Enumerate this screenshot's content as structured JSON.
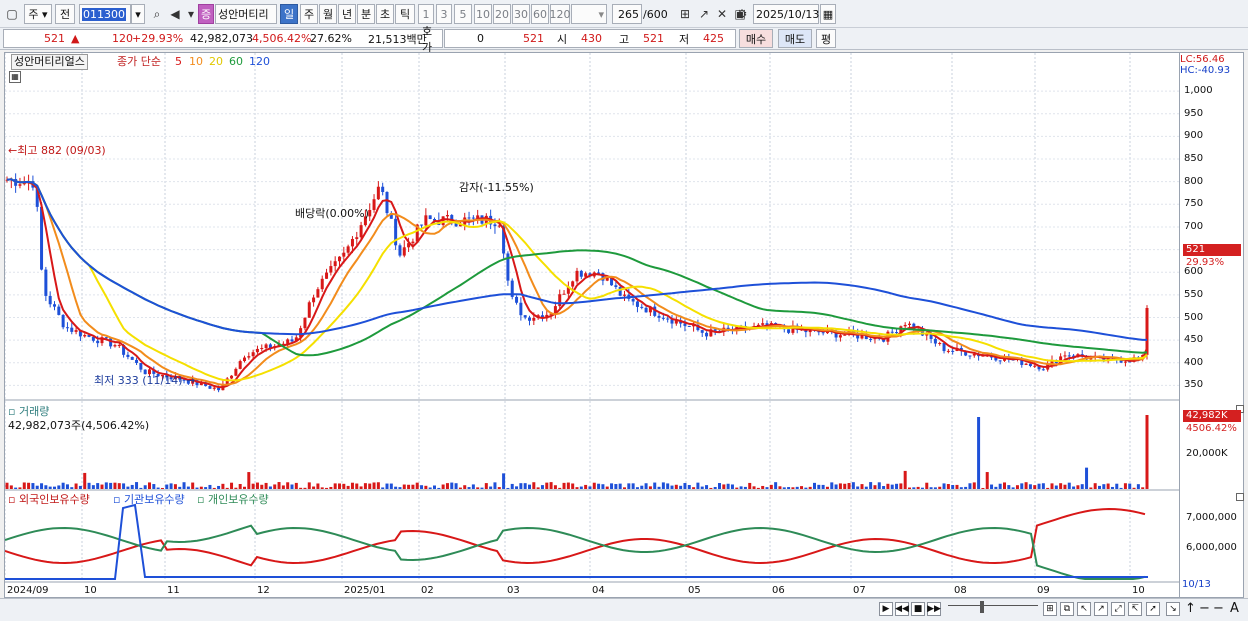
{
  "toolbar": {
    "period_mode": "주",
    "prev_label": "전",
    "code_value": "011300",
    "stock_badge": "증",
    "stock_name": "성안머티리",
    "timeframes": [
      "일",
      "주",
      "월",
      "년",
      "분",
      "초",
      "틱"
    ],
    "active_timeframe": "일",
    "intervals": [
      "1",
      "3",
      "5",
      "10",
      "20",
      "30",
      "60",
      "120"
    ],
    "count_value": "265",
    "count_max": "/600",
    "date_value": "2025/10/13"
  },
  "quote": {
    "price": "521",
    "change": "120",
    "change_pct": "+29.93%",
    "volume": "42,982,073",
    "volume_pct": "4,506.42%",
    "turnover_pct": "27.62%",
    "amount": "21,513백만",
    "hoga_label": "호가",
    "hoga_value": "0",
    "hoga_price": "521",
    "open_label": "시",
    "open": "430",
    "high_label": "고",
    "high": "521",
    "low_label": "저",
    "low": "425",
    "buy_label": "매수",
    "sell_label": "매도",
    "eval_label": "평"
  },
  "legend": {
    "name": "성안머티리얼스",
    "ma_label": "종가 단순",
    "ma_periods": [
      "5",
      "10",
      "20",
      "60",
      "120"
    ],
    "ma_colors": [
      "#d81818",
      "#f28c1c",
      "#f5e000",
      "#1e9a3c",
      "#1e50d8"
    ]
  },
  "annotations": {
    "high": "←최고 882 (09/03)",
    "low": "최저 333 (11/14) →",
    "dividend": "배당락(0.00%)",
    "capital_reduction": "감자(-11.55%)"
  },
  "price_axis": {
    "lc": "LC:56.46",
    "hc": "HC:-40.93",
    "ticks": [
      "1,000",
      "950",
      "900",
      "850",
      "800",
      "750",
      "700",
      "650",
      "600",
      "550",
      "500",
      "450",
      "400",
      "350"
    ],
    "last_price": "521",
    "last_change": "29.93%"
  },
  "volume_panel": {
    "title": "거래량",
    "value": "42,982,073주(4,506.42%)",
    "tag_value": "42,982K",
    "tag_pct": "4506.42%",
    "tick": "20,000K"
  },
  "holdings_panel": {
    "legend": [
      "외국인보유수량",
      "기관보유수량",
      "개인보유수량"
    ],
    "colors": [
      "#d81818",
      "#1e50d8",
      "#2e8b57"
    ],
    "ticks": [
      "7,000,000",
      "6,000,000"
    ]
  },
  "x_axis": {
    "labels": [
      "2024/09",
      "10",
      "11",
      "12",
      "2025/01",
      "02",
      "03",
      "04",
      "05",
      "06",
      "07",
      "08",
      "09",
      "10"
    ],
    "end_label": "10/13"
  },
  "chart_data": {
    "type": "candlestick",
    "ylim": [
      320,
      1040
    ],
    "key_points": [
      {
        "label": "최고",
        "value": 882,
        "date": "09/03"
      },
      {
        "label": "최저",
        "value": 333,
        "date": "11/14"
      },
      {
        "label": "last",
        "value": 521,
        "date": "10/13"
      }
    ],
    "volume": {
      "last": 42982073,
      "last_pct": 4506.42
    },
    "holdings_ticks": [
      7000000,
      6000000
    ]
  },
  "colors": {
    "up": "#d81818",
    "down": "#1e50d8",
    "accent": "#3c73c8"
  }
}
